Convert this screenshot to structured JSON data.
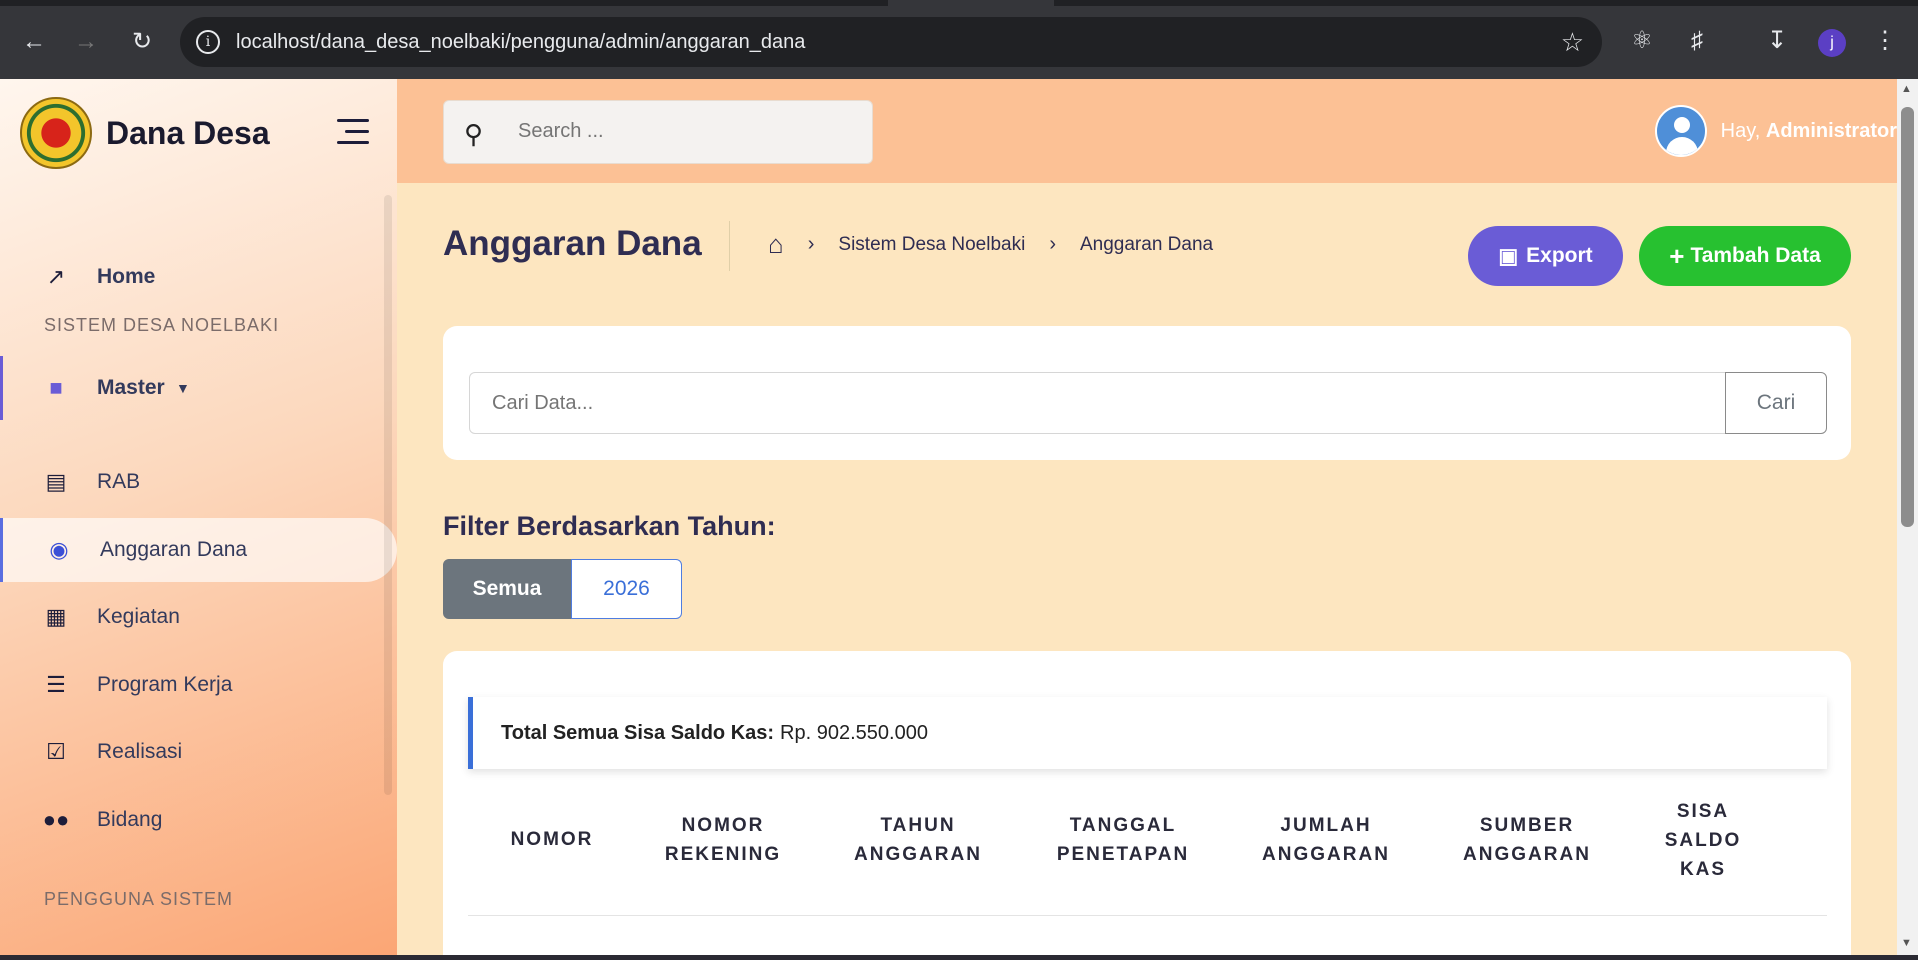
{
  "browser": {
    "url": "localhost/dana_desa_noelbaki/pengguna/admin/anggaran_dana",
    "profile_initial": "j"
  },
  "sidebar": {
    "brand": "Dana Desa",
    "home_label": "Home",
    "section_sistem": "SISTEM DESA NOELBAKI",
    "master_label": "Master",
    "items": [
      {
        "label": "RAB",
        "icon": "document-icon"
      },
      {
        "label": "Anggaran Dana",
        "icon": "coins-icon"
      },
      {
        "label": "Kegiatan",
        "icon": "calendar-icon"
      },
      {
        "label": "Program Kerja",
        "icon": "list-check-icon"
      },
      {
        "label": "Realisasi",
        "icon": "calendar-check-icon"
      },
      {
        "label": "Bidang",
        "icon": "users-icon"
      }
    ],
    "section_pengguna": "PENGGUNA SISTEM"
  },
  "header": {
    "search_placeholder": "Search ...",
    "greeting": "Hay,",
    "username": "Administrator"
  },
  "page": {
    "title": "Anggaran Dana",
    "breadcrumb": [
      "Sistem Desa Noelbaki",
      "Anggaran Dana"
    ],
    "export_label": "Export",
    "add_label": "Tambah Data"
  },
  "search": {
    "placeholder": "Cari Data...",
    "button": "Cari"
  },
  "filter": {
    "title": "Filter Berdasarkan Tahun:",
    "options": [
      "Semua",
      "2026"
    ],
    "selected": "Semua"
  },
  "summary": {
    "label": "Total Semua Sisa Saldo Kas:",
    "value": "Rp. 902.550.000"
  },
  "table": {
    "headers": [
      [
        "NOMOR"
      ],
      [
        "NOMOR",
        "REKENING"
      ],
      [
        "TAHUN",
        "ANGGARAN"
      ],
      [
        "TANGGAL",
        "PENETAPAN"
      ],
      [
        "JUMLAH",
        "ANGGARAN"
      ],
      [
        "SUMBER",
        "ANGGARAN"
      ],
      [
        "SISA",
        "SALDO",
        "KAS"
      ]
    ]
  },
  "colors": {
    "export": "#6a5cd6",
    "add": "#27c130",
    "accent_blue": "#3a6fd8",
    "header_bg": "#fcc195",
    "page_bg": "#fde6c0"
  }
}
